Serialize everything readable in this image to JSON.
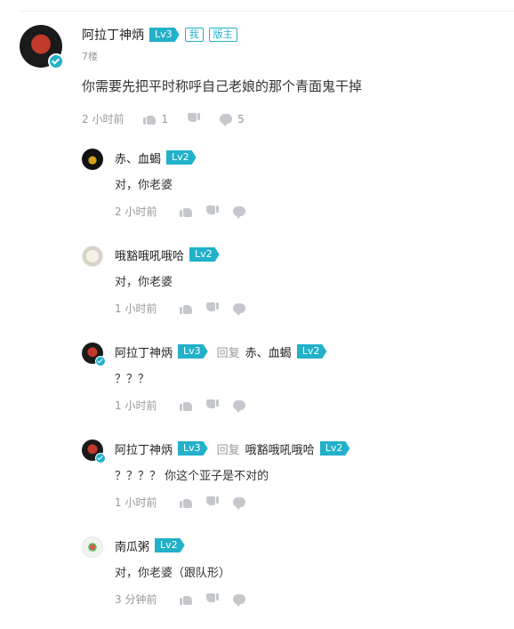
{
  "main": {
    "username": "阿拉丁神炳",
    "level": "Lv3",
    "tags": [
      "我",
      "版主"
    ],
    "floor": "7楼",
    "content": "你需要先把平时称呼自己老娘的那个青面鬼干掉",
    "time": "2 小时前",
    "likes": "1",
    "replies": "5"
  },
  "replies": [
    {
      "username": "赤、血蝎",
      "level": "Lv2",
      "reply_to": "",
      "reply_to_level": "",
      "content": "对，你老婆",
      "time": "2 小时前"
    },
    {
      "username": "哦豁哦吼哦哈",
      "level": "Lv2",
      "reply_to": "",
      "reply_to_level": "",
      "content": "对，你老婆",
      "time": "1 小时前"
    },
    {
      "username": "阿拉丁神炳",
      "level": "Lv3",
      "reply_word": "回复",
      "reply_to": "赤、血蝎",
      "reply_to_level": "Lv2",
      "content": "？？？",
      "time": "1 小时前"
    },
    {
      "username": "阿拉丁神炳",
      "level": "Lv3",
      "reply_word": "回复",
      "reply_to": "哦豁哦吼哦哈",
      "reply_to_level": "Lv2",
      "content": "？？？？ 你这个亚子是不对的",
      "time": "1 小时前"
    },
    {
      "username": "南瓜粥",
      "level": "Lv2",
      "reply_to": "",
      "reply_to_level": "",
      "content": "对，你老婆（跟队形）",
      "time": "3 分钟前"
    }
  ],
  "colors": {
    "accent": "#21b1c9",
    "muted": "#999999",
    "icon": "#c4c8cc"
  }
}
